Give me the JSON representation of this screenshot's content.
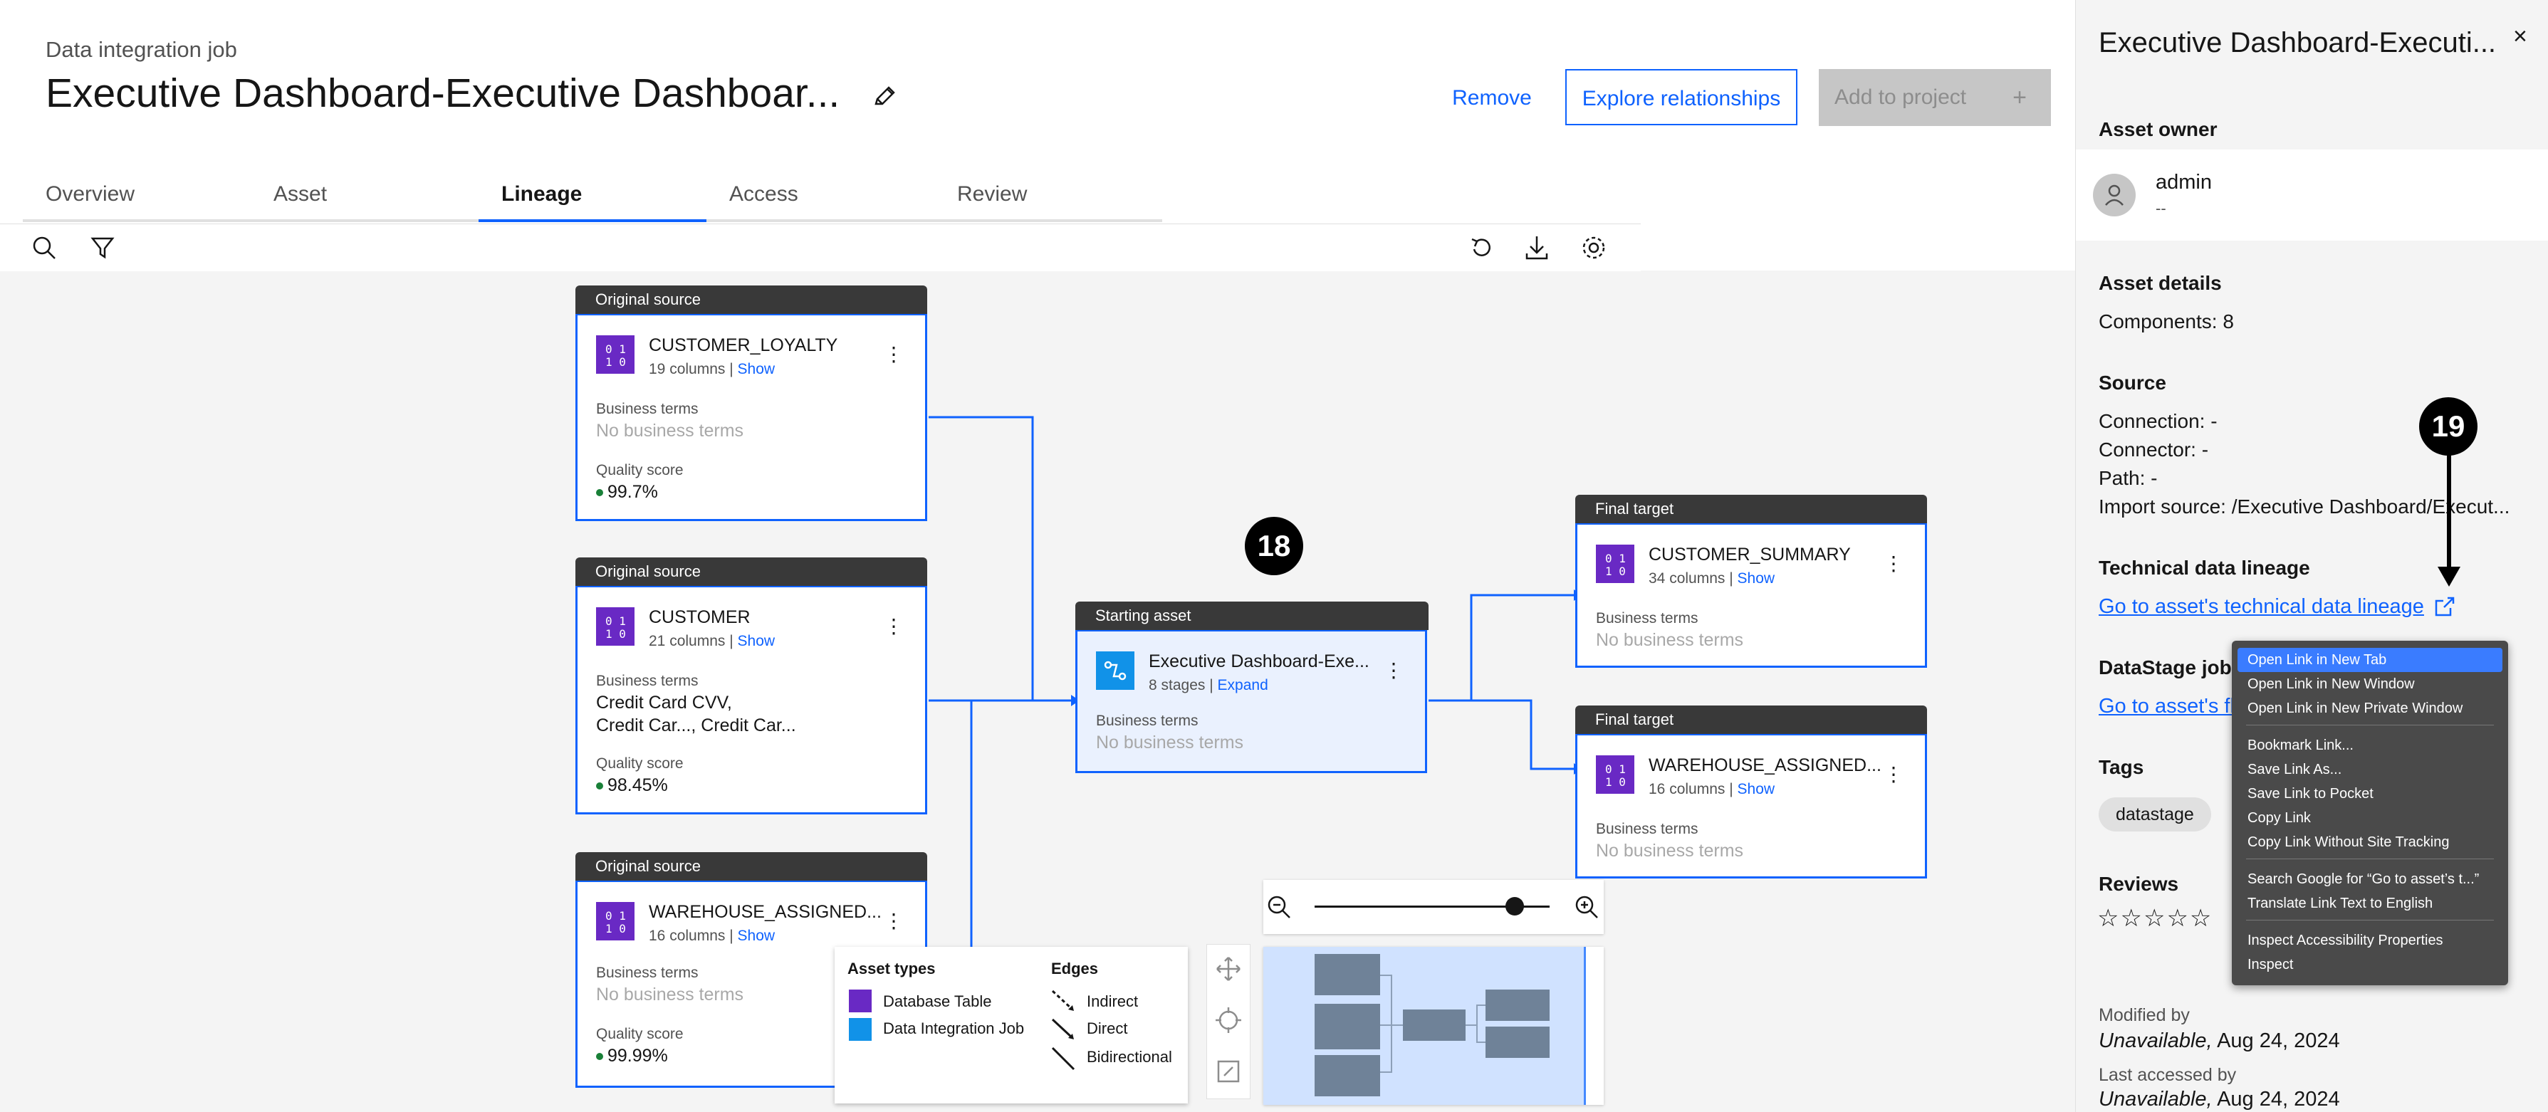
{
  "header": {
    "supertitle": "Data integration job",
    "title": "Executive Dashboard-Executive Dashboar...",
    "remove_label": "Remove",
    "explore_label": "Explore relationships",
    "add_label": "Add to project",
    "add_icon": "+"
  },
  "tabs": [
    {
      "label": "Overview"
    },
    {
      "label": "Asset"
    },
    {
      "label": "Lineage"
    },
    {
      "label": "Access"
    },
    {
      "label": "Review"
    }
  ],
  "active_tab": "Lineage",
  "toolbar_icons": [
    "search-icon",
    "filter-icon",
    "reset-icon",
    "download-icon",
    "settings-icon"
  ],
  "nodes": {
    "n1": {
      "header": "Original source",
      "name": "CUSTOMER_LOYALTY",
      "sub_text": "19 columns |",
      "sub_link": "Show",
      "bt_label": "Business terms",
      "bt_value": "No business terms",
      "q_label": "Quality score",
      "q_value": "99.7%"
    },
    "n2": {
      "header": "Original source",
      "name": "CUSTOMER",
      "sub_text": "21 columns |",
      "sub_link": "Show",
      "bt_label": "Business terms",
      "bt_line1": "Credit Card CVV,",
      "bt_line2": "Credit Car..., Credit Car...",
      "q_label": "Quality score",
      "q_value": "98.45%"
    },
    "n3": {
      "header": "Original source",
      "name": "WAREHOUSE_ASSIGNED...",
      "sub_text": "16 columns |",
      "sub_link": "Show",
      "bt_label": "Business terms",
      "bt_value": "No business terms",
      "q_label": "Quality score",
      "q_value": "99.99%"
    },
    "start": {
      "header": "Starting asset",
      "name": "Executive Dashboard-Exe...",
      "sub_text": "8 stages |",
      "sub_link": "Expand",
      "bt_label": "Business terms",
      "bt_value": "No business terms"
    },
    "t1": {
      "header": "Final target",
      "name": "CUSTOMER_SUMMARY",
      "sub_text": "34 columns |",
      "sub_link": "Show",
      "bt_label": "Business terms",
      "bt_value": "No business terms"
    },
    "t2": {
      "header": "Final target",
      "name": "WAREHOUSE_ASSIGNED...",
      "sub_text": "16 columns |",
      "sub_link": "Show",
      "bt_label": "Business terms",
      "bt_value": "No business terms"
    }
  },
  "badges": {
    "b18": "18",
    "b19": "19"
  },
  "legend": {
    "asset_types_title": "Asset types",
    "asset_types": [
      "Database Table",
      "Data Integration Job"
    ],
    "edges_title": "Edges",
    "edges": [
      "Indirect",
      "Direct",
      "Bidirectional"
    ]
  },
  "zoom": {
    "level": 0.85
  },
  "panel": {
    "title": "Executive Dashboard-Executi...",
    "close": "×",
    "owner_title": "Asset owner",
    "owner_name": "admin",
    "owner_sub": "--",
    "details_title": "Asset details",
    "components": "Components: 8",
    "source_title": "Source",
    "connection": "Connection: -",
    "connector": "Connector: -",
    "path": "Path: -",
    "import_source": "Import source: /Executive Dashboard/Execut...",
    "lineage_title": "Technical data lineage",
    "lineage_link": "Go to asset's technical data lineage",
    "datastage_title": "DataStage job",
    "datastage_link": "Go to asset's fl",
    "tags_title": "Tags",
    "tag": "datastage",
    "reviews_title": "Reviews",
    "rating_stars": 0,
    "modified_label": "Modified by",
    "modified_who": "Unavailable,",
    "modified_date": "Aug 24, 2024",
    "accessed_label": "Last accessed by",
    "accessed_who": "Unavailable,",
    "accessed_date": "Aug 24, 2024"
  },
  "context_menu": [
    {
      "label": "Open Link in New Tab",
      "highlight": true
    },
    {
      "label": "Open Link in New Window"
    },
    {
      "label": "Open Link in New Private Window"
    },
    {
      "label": "Bookmark Link..."
    },
    {
      "label": "Save Link As..."
    },
    {
      "label": "Save Link to Pocket"
    },
    {
      "label": "Copy Link"
    },
    {
      "label": "Copy Link Without Site Tracking"
    },
    {
      "label": "Search Google for “Go to asset’s t...”"
    },
    {
      "label": "Translate Link Text to English"
    },
    {
      "label": "Inspect Accessibility Properties"
    },
    {
      "label": "Inspect"
    }
  ],
  "colors": {
    "primary": "#0f62fe",
    "table_icon": "#6929c4",
    "job_icon": "#1192e8",
    "quality_dot": "#198038"
  }
}
